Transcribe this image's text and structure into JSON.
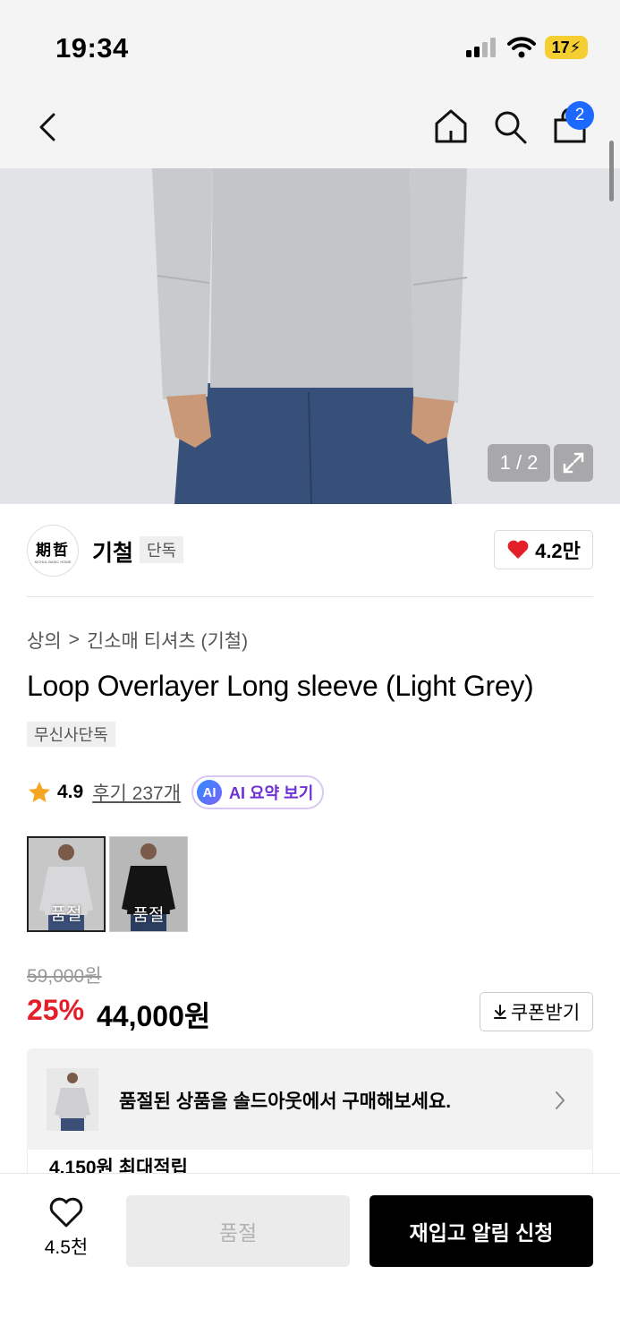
{
  "status_bar": {
    "time": "19:34",
    "battery": "17"
  },
  "nav": {
    "cart_count": "2"
  },
  "gallery": {
    "counter": "1 / 2"
  },
  "brand": {
    "logo_text": "期哲",
    "logo_subtext": "KICHUL BASIC HOME",
    "name": "기철",
    "tag": "단독",
    "likes": "4.2만"
  },
  "breadcrumb": {
    "category": "상의",
    "separator": ">",
    "subcategory": "긴소매 티셔츠 (기철)"
  },
  "product": {
    "title": "Loop Overlayer Long sleeve (Light Grey)",
    "exclusive_tag": "무신사단독",
    "rating": "4.9",
    "reviews": "후기 237개",
    "ai_badge": "AI",
    "ai_summary": "AI 요약 보기"
  },
  "swatches": [
    {
      "label": "품절",
      "color": "light-grey"
    },
    {
      "label": "품절",
      "color": "black"
    }
  ],
  "price": {
    "original": "59,000원",
    "discount": "25%",
    "sale": "44,000원",
    "coupon": "쿠폰받기"
  },
  "soldout_banner": {
    "text": "품절된 상품을 솔드아웃에서 구매해보세요."
  },
  "points": {
    "text": "4,150원 최대적립"
  },
  "bottom_bar": {
    "wish_count": "4.5천",
    "soldout_label": "품절",
    "restock_label": "재입고 알림 신청"
  },
  "colors": {
    "accent_red": "#e3202a",
    "badge_blue": "#1d68ff",
    "ai_purple": "#6e2fd3"
  }
}
